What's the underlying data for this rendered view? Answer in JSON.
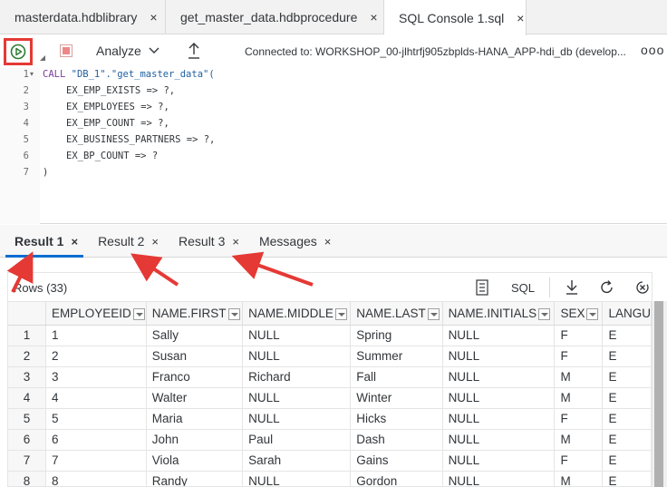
{
  "editor_tabs": [
    {
      "label": "masterdata.hdblibrary",
      "close": "×"
    },
    {
      "label": "get_master_data.hdbprocedure",
      "close": "×"
    },
    {
      "label": "SQL Console 1.sql",
      "close": "×"
    }
  ],
  "toolbar": {
    "analyze_label": "Analyze",
    "connection_text": "Connected to: WORKSHOP_00-jlhtrfj905zbplds-HANA_APP-hdi_db (develop...",
    "more_label": "ooo"
  },
  "code": {
    "line_numbers": [
      "1",
      "2",
      "3",
      "4",
      "5",
      "6",
      "7"
    ],
    "line1_kw": "CALL",
    "line1_rest": "\"DB_1\".\"get_master_data\"(",
    "line2": "EX_EMP_EXISTS => ?,",
    "line3": "EX_EMPLOYEES => ?,",
    "line4": "EX_EMP_COUNT => ?,",
    "line5": "EX_BUSINESS_PARTNERS => ?,",
    "line6": "EX_BP_COUNT => ?",
    "line7": ")"
  },
  "result_tabs": [
    {
      "label": "Result 1",
      "close": "×"
    },
    {
      "label": "Result 2",
      "close": "×"
    },
    {
      "label": "Result 3",
      "close": "×"
    },
    {
      "label": "Messages",
      "close": "×"
    }
  ],
  "results": {
    "rows_label": "Rows (33)",
    "sql_label": "SQL",
    "columns": [
      "EMPLOYEEID",
      "NAME.FIRST",
      "NAME.MIDDLE",
      "NAME.LAST",
      "NAME.INITIALS",
      "SEX",
      "LANGU"
    ],
    "rows": [
      [
        "1",
        "1",
        "Sally",
        "NULL",
        "Spring",
        "NULL",
        "F",
        "E"
      ],
      [
        "2",
        "2",
        "Susan",
        "NULL",
        "Summer",
        "NULL",
        "F",
        "E"
      ],
      [
        "3",
        "3",
        "Franco",
        "Richard",
        "Fall",
        "NULL",
        "M",
        "E"
      ],
      [
        "4",
        "4",
        "Walter",
        "NULL",
        "Winter",
        "NULL",
        "M",
        "E"
      ],
      [
        "5",
        "5",
        "Maria",
        "NULL",
        "Hicks",
        "NULL",
        "F",
        "E"
      ],
      [
        "6",
        "6",
        "John",
        "Paul",
        "Dash",
        "NULL",
        "M",
        "E"
      ],
      [
        "7",
        "7",
        "Viola",
        "Sarah",
        "Gains",
        "NULL",
        "F",
        "E"
      ],
      [
        "8",
        "8",
        "Randy",
        "NULL",
        "Gordon",
        "NULL",
        "M",
        "E"
      ]
    ]
  },
  "colors": {
    "annotation_red": "#e53935",
    "run_green": "#2e7d32",
    "active_tab_underline": "#0a6ed1"
  }
}
